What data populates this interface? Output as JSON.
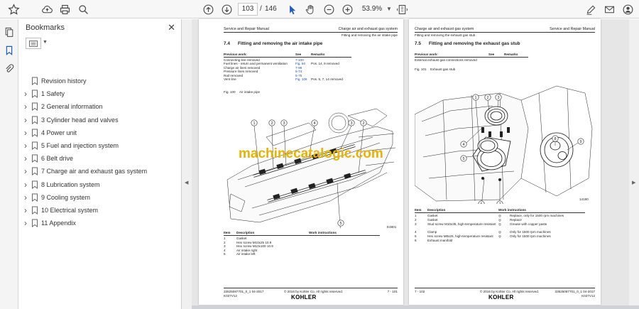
{
  "toolbar": {
    "page_current": "103",
    "page_sep": "/",
    "page_total": "146",
    "zoom": "53.9%"
  },
  "bookmarks": {
    "title": "Bookmarks",
    "items": [
      {
        "label": "Revision history",
        "expandable": false
      },
      {
        "label": "1 Safety",
        "expandable": true
      },
      {
        "label": "2 General information",
        "expandable": true
      },
      {
        "label": "3 Cylinder head and valves",
        "expandable": true
      },
      {
        "label": "4 Power unit",
        "expandable": true
      },
      {
        "label": "5 Fuel and injection system",
        "expandable": true
      },
      {
        "label": "6 Belt drive",
        "expandable": true
      },
      {
        "label": "7 Charge air and exhaust gas system",
        "expandable": true
      },
      {
        "label": "8 Lubrication system",
        "expandable": true
      },
      {
        "label": "9 Cooling system",
        "expandable": true
      },
      {
        "label": "10 Electrical system",
        "expandable": true
      },
      {
        "label": "11 Appendix",
        "expandable": true
      }
    ]
  },
  "watermark": "machinecatalogic.com",
  "left_page": {
    "header_left": "Service and Repair Manual",
    "header_right": "Charge air and exhaust gas system",
    "header_sub": "Fitting and removing the air intake pipe",
    "section_num": "7.4",
    "section_title": "Fitting and removing the air intake pipe",
    "prev_work_header": "Previous work:",
    "see_header": "See",
    "remarks_header": "Remarks",
    "prev_work": [
      {
        "work": "Connecting line removed",
        "see": "7-100",
        "remark": ""
      },
      {
        "work": "Fuel lines - return and permanent ventilation",
        "see": "Fig. 50",
        "remark": "Pos. 14, 9 removed"
      },
      {
        "work": "Charge air lines removed",
        "see": "7-98",
        "remark": ""
      },
      {
        "work": "Pressure lines removed",
        "see": "5-74",
        "remark": ""
      },
      {
        "work": "Rail removed",
        "see": "5-75",
        "remark": ""
      },
      {
        "work": "Vent line",
        "see": "Fig. 106",
        "remark": "Pos. 5, 7, 14 removed"
      }
    ],
    "fig_label": "Fig. 100",
    "fig_caption": "Air intake pipe",
    "fig_code": "E4801",
    "callouts": [
      "1",
      "2",
      "3",
      "4",
      "3",
      "2",
      "5",
      "6"
    ],
    "items_header": {
      "item": "Item",
      "desc": "Description",
      "work": "Work instructions"
    },
    "items": [
      {
        "item": "1",
        "desc": "Gasket"
      },
      {
        "item": "2",
        "desc": "Hex screw M10x25 10.9"
      },
      {
        "item": "3",
        "desc": "Hex screw M10x100 10.9"
      },
      {
        "item": "4",
        "desc": "Air intake right"
      },
      {
        "item": "5",
        "desc": "Air intake left"
      }
    ],
    "footer_doc": "33525087701_0_1 04-2017",
    "footer_doc2": "K027V12",
    "footer_copy": "© 2016 by Kohler Co. All rights reserved.",
    "footer_page": "7 - 101",
    "brand": "KOHLER"
  },
  "right_page": {
    "header_left": "Charge air and exhaust gas system",
    "header_sub": "Fitting and removing the exhaust gas stub",
    "header_right": "Service and Repair Manual",
    "section_num": "7.5",
    "section_title": "Fitting and removing the exhaust gas stub",
    "prev_work_header": "Previous work:",
    "see_header": "See",
    "remarks_header": "Remarks",
    "prev_work": [
      {
        "work": "External exhaust gas connections removed",
        "see": "",
        "remark": ""
      }
    ],
    "fig_label": "Fig. 101",
    "fig_caption": "Exhaust gas stub",
    "fig_code": "14180",
    "callouts": [
      "1",
      "2",
      "3",
      "4",
      "5",
      "6",
      "7",
      "8",
      "9"
    ],
    "items_header": {
      "item": "Item",
      "desc": "Description",
      "work": "Work instructions"
    },
    "items": [
      {
        "item": "1",
        "desc": "Gasket",
        "mark": "◎",
        "work": "Replace, only for 1500 rpm machines"
      },
      {
        "item": "2",
        "desc": "Gasket",
        "mark": "◎",
        "work": "Replace"
      },
      {
        "item": "3",
        "desc": "Stud screw M10x35, high-temperature resistant",
        "mark": "◎",
        "work": "Grease with copper paste"
      },
      {
        "item": "4",
        "desc": "Clamp",
        "mark": "◎",
        "work": "Only for 1500 rpm machines"
      },
      {
        "item": "5",
        "desc": "Hex screw M8x25, high-temperature resistant",
        "mark": "◎",
        "work": "Only for 1500 rpm machines"
      },
      {
        "item": "6",
        "desc": "Exhaust manifold",
        "mark": "",
        "work": ""
      }
    ],
    "footer_page": "7 - 102",
    "footer_copy": "© 2016 by Kohler Co. All rights reserved.",
    "footer_doc": "33525087701_0_1 04-2017",
    "footer_doc2": "K027V12",
    "brand": "KOHLER"
  }
}
